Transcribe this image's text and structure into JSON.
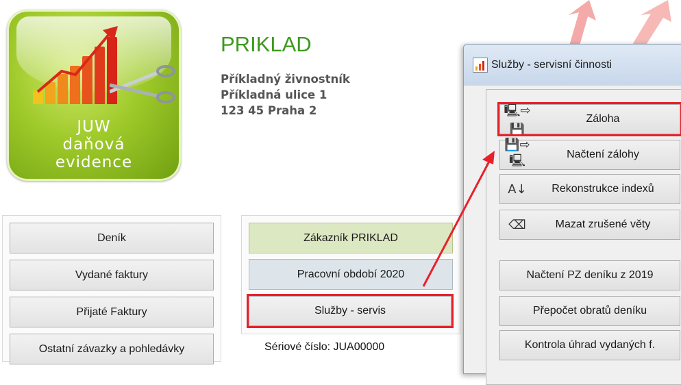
{
  "logo": {
    "line1": "JUW",
    "line2": "daňová",
    "line3": "evidence"
  },
  "company": {
    "name": "PRIKLAD",
    "line1": "Příkladný živnostník",
    "line2": "Příkladná ulice 1",
    "line3": "123 45 Praha 2"
  },
  "left_buttons": {
    "denik": "Deník",
    "vydane": "Vydané faktury",
    "prijate": "Přijaté Faktury",
    "ostatni": "Ostatní závazky a pohledávky"
  },
  "mid_buttons": {
    "zakaznik": "Zákazník  PRIKLAD",
    "obdobi": "Pracovní období 2020",
    "sluzby": "Služby - servis"
  },
  "serial": "Sériové číslo: JUA00000",
  "dialog": {
    "title": "Služby - servisní činnosti",
    "buttons": {
      "zaloha": "Záloha",
      "nacteni": "Načtení zálohy",
      "rekonstrukce": "Rekonstrukce indexů",
      "mazat": "Mazat zrušené věty",
      "nacteni_pz": "Načtení PZ deníku z 2019",
      "prepocet": "Přepočet obratů deníku",
      "kontrola": "Kontrola úhrad vydaných f."
    }
  },
  "colors": {
    "highlight": "#e8202a",
    "company_green": "#3c9a1c"
  }
}
